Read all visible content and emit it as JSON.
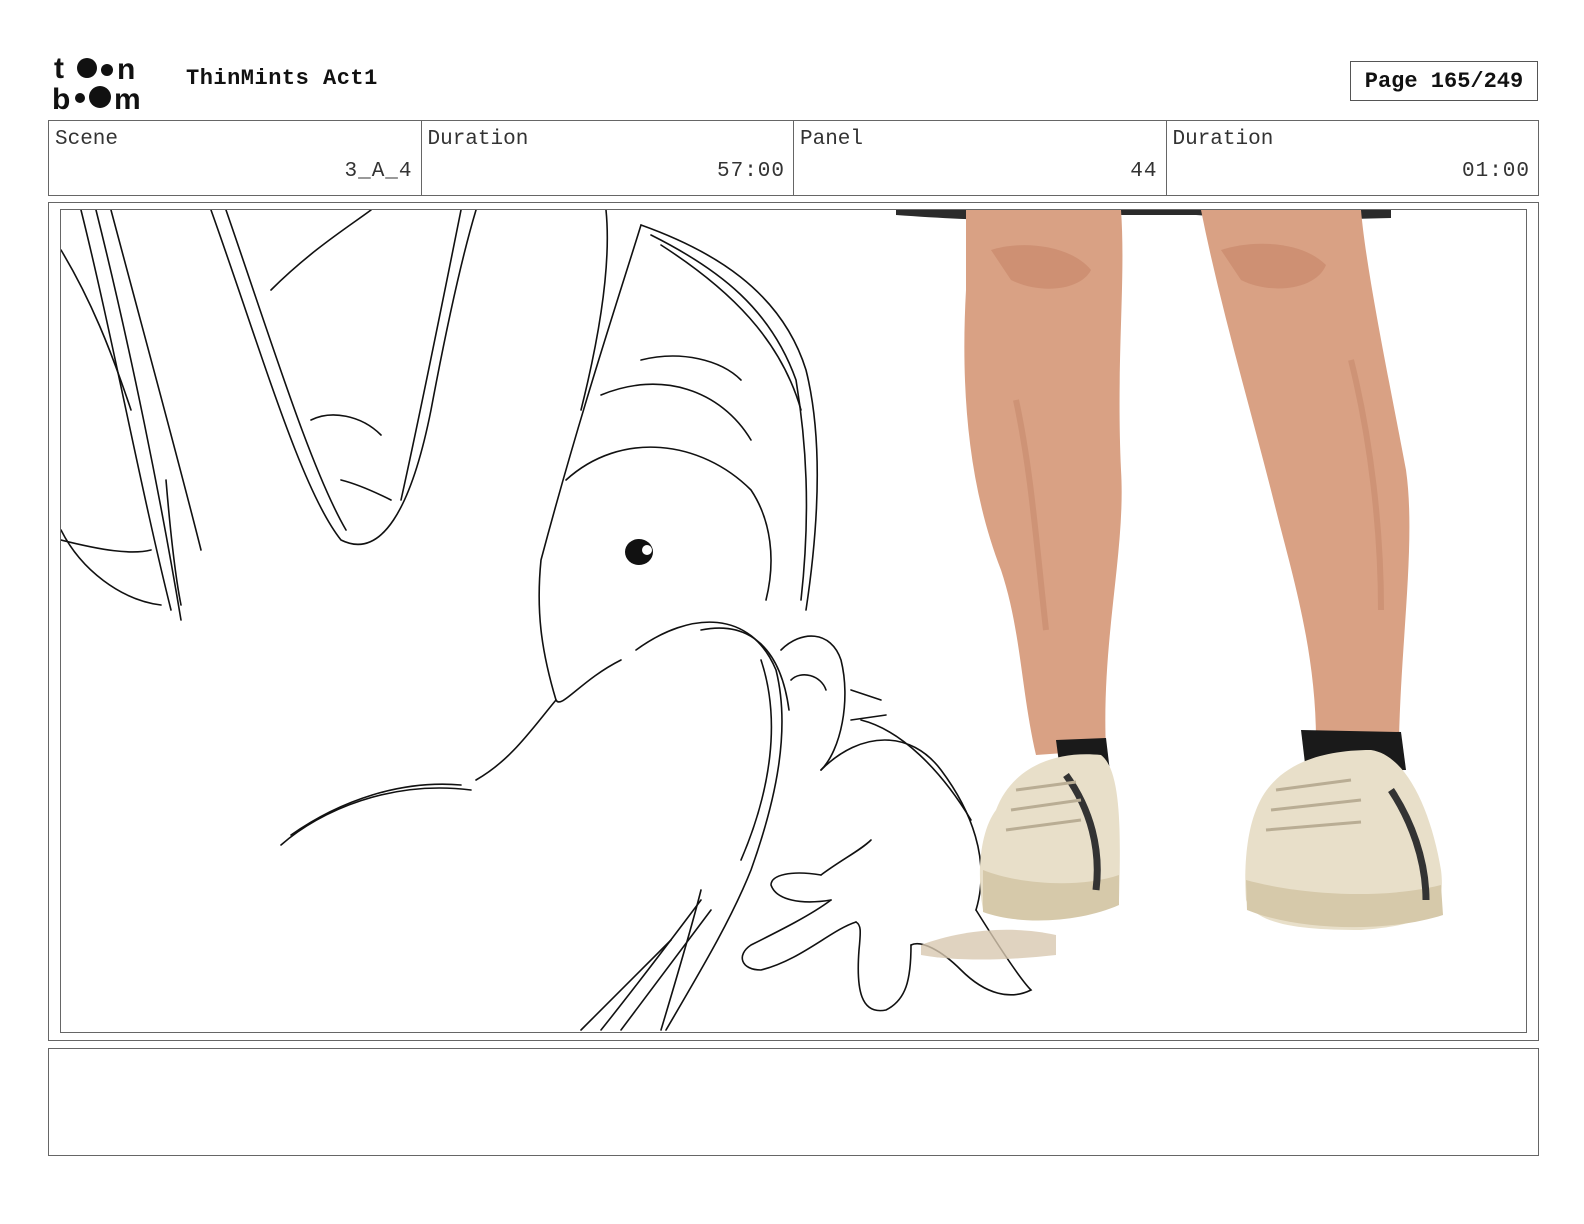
{
  "header": {
    "logo_text": "toonboom",
    "project_title": "ThinMints Act1",
    "page_label": "Page",
    "page_number": "165/249"
  },
  "info": [
    {
      "label": "Scene",
      "value": "3_A_4"
    },
    {
      "label": "Duration",
      "value": "57:00"
    },
    {
      "label": "Panel",
      "value": "44"
    },
    {
      "label": "Duration",
      "value": "01:00"
    }
  ],
  "panel": {
    "description": "",
    "notes": ""
  },
  "colors": {
    "frame": "#666666",
    "skin": "#d9a184",
    "shoe": "#e8dfc9",
    "sock": "#1a1a1a",
    "shorts": "#2b2b2b"
  },
  "icons": [
    "toonboom-logo"
  ]
}
